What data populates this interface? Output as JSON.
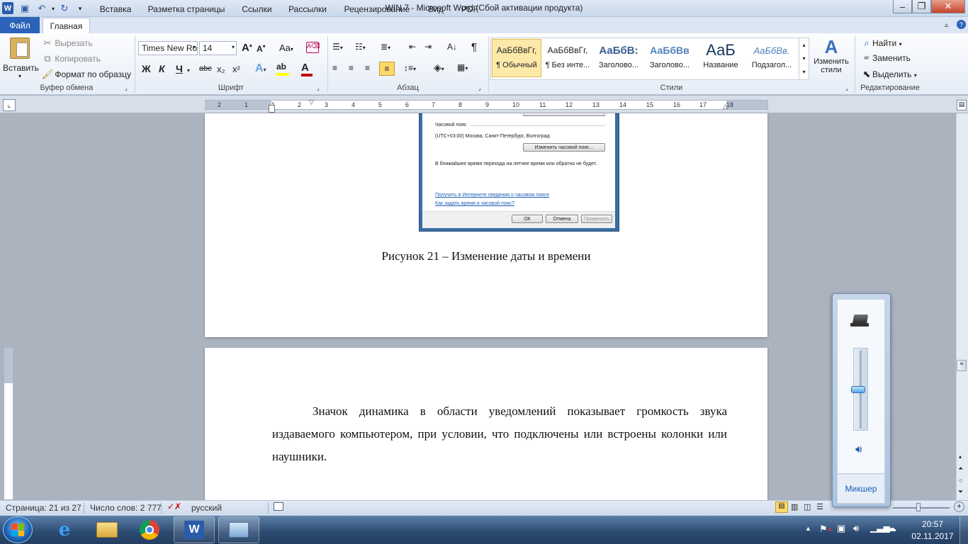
{
  "window": {
    "title": "WIN 7  -  Microsoft Word (Сбой активации продукта)",
    "app_icon": "W"
  },
  "ribbon_tabs": [
    "Файл",
    "Главная",
    "Вставка",
    "Разметка страницы",
    "Ссылки",
    "Рассылки",
    "Рецензирование",
    "Вид",
    "PDF"
  ],
  "clipboard": {
    "paste": "Вставить",
    "cut": "Вырезать",
    "copy": "Копировать",
    "format_painter": "Формат по образцу",
    "label": "Буфер обмена"
  },
  "font": {
    "family": "Times New Ro",
    "size": "14",
    "label": "Шрифт",
    "bold": "Ж",
    "italic": "К",
    "underline": "Ч",
    "strike": "abc",
    "subscript": "x₂",
    "superscript": "x²",
    "grow": "A",
    "shrink": "A",
    "case": "Aa"
  },
  "paragraph": {
    "label": "Абзац",
    "pilcrow": "¶"
  },
  "styles": {
    "label": "Стили",
    "items": [
      {
        "sample": "АаБбВвГг,",
        "name": "¶ Обычный"
      },
      {
        "sample": "АаБбВвГг,",
        "name": "¶ Без инте..."
      },
      {
        "sample": "АаБбВ:",
        "name": "Заголово..."
      },
      {
        "sample": "АаБбВв",
        "name": "Заголово..."
      },
      {
        "sample": "АаБ",
        "name": "Название"
      },
      {
        "sample": "АаБбВв.",
        "name": "Подзагол..."
      }
    ],
    "change": "Изменить стили"
  },
  "editing": {
    "find": "Найти",
    "replace": "Заменить",
    "select": "Выделить",
    "label": "Редактирование"
  },
  "ruler_numbers": [
    "2",
    "1",
    "1",
    "2",
    "3",
    "4",
    "5",
    "6",
    "7",
    "8",
    "9",
    "10",
    "11",
    "12",
    "13",
    "14",
    "15",
    "16",
    "17",
    "18"
  ],
  "screenshot": {
    "timezone_label": "Часовой пояс",
    "timezone_value": "(UTC+03:00) Москва, Санкт-Петербург, Волгоград",
    "change_tz_button": "Изменить часовой пояс...",
    "dst_note": "В ближайшее время перехода на летнее время или обратно не будет.",
    "link1": "Получить в Интернете сведения о часовом поясе",
    "link2": "Как задать время и часовой пояс?",
    "ok": "ОК",
    "cancel": "Отмена",
    "apply": "Применить"
  },
  "document": {
    "caption": "Рисунок 21 – Изменение даты и времени",
    "paragraph": "Значок динамика в области уведомлений показывает громкость звука издаваемого компьютером, при условии, что подключены или встроены колонки или наушники."
  },
  "status": {
    "page": "Страница: 21 из 27",
    "words": "Число слов: 2 777",
    "language": "русский"
  },
  "volume": {
    "mixer": "Микшер",
    "level": 0.5
  },
  "clock": {
    "time": "20:57",
    "date": "02.11.2017"
  }
}
